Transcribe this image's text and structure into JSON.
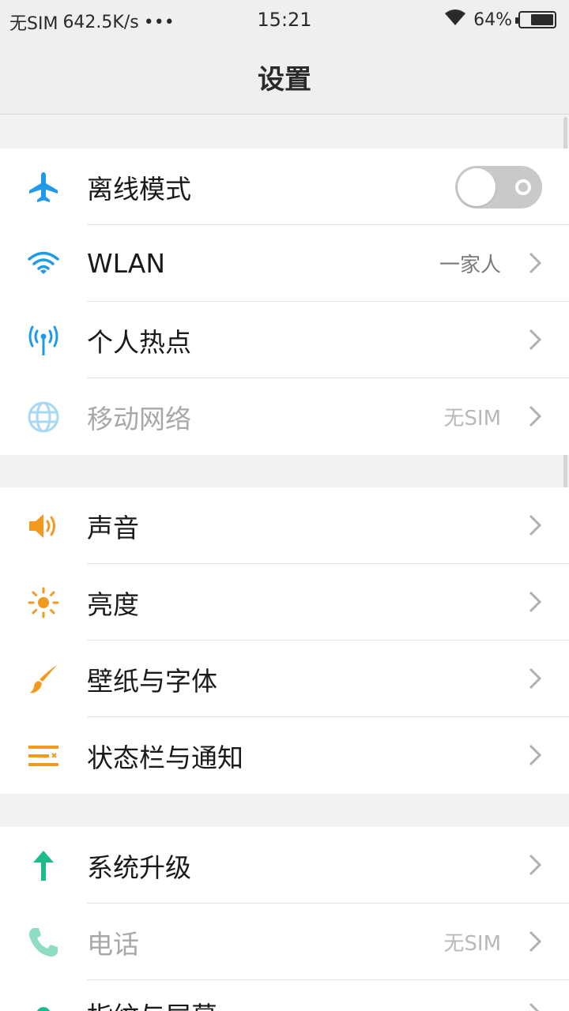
{
  "status_bar": {
    "carrier": "无SIM",
    "speed": "642.5K/s",
    "more": "•••",
    "time": "15:21",
    "battery": "64%",
    "battery_level": 0.64
  },
  "header": {
    "title": "设置"
  },
  "groups": [
    {
      "items": [
        {
          "label": "离线模式",
          "icon": "airplane-icon",
          "control": "toggle",
          "toggle_on": false
        },
        {
          "label": "WLAN",
          "icon": "wifi-icon",
          "value": "一家人"
        },
        {
          "label": "个人热点",
          "icon": "hotspot-icon"
        },
        {
          "label": "移动网络",
          "icon": "globe-icon",
          "value": "无SIM",
          "disabled": true
        }
      ]
    },
    {
      "items": [
        {
          "label": "声音",
          "icon": "speaker-icon"
        },
        {
          "label": "亮度",
          "icon": "sun-icon"
        },
        {
          "label": "壁纸与字体",
          "icon": "brush-icon"
        },
        {
          "label": "状态栏与通知",
          "icon": "statusbar-icon"
        }
      ]
    },
    {
      "items": [
        {
          "label": "系统升级",
          "icon": "arrow-up-icon"
        },
        {
          "label": "电话",
          "icon": "phone-icon",
          "value": "无SIM",
          "disabled": true
        },
        {
          "label": "指纹与屏幕",
          "icon": "fingerprint-icon"
        }
      ]
    }
  ],
  "colors": {
    "blue": "#1e9be8",
    "light_blue": "#a8d8f2",
    "orange": "#f39a1e",
    "green": "#1abc8c",
    "light_green": "#8fdcc4"
  }
}
